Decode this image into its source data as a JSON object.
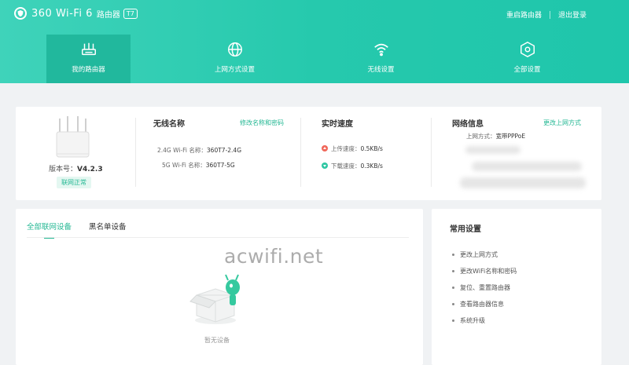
{
  "header": {
    "brand": "360 Wi-Fi 6",
    "subtitle": "路由器",
    "badge": "T7",
    "links": [
      "重启路由器",
      "退出登录"
    ]
  },
  "nav": {
    "items": [
      {
        "label": "我的路由器",
        "icon": "router-icon",
        "active": true
      },
      {
        "label": "上网方式设置",
        "icon": "globe-icon",
        "active": false
      },
      {
        "label": "无线设置",
        "icon": "wifi-icon",
        "active": false
      },
      {
        "label": "全部设置",
        "icon": "hexagon-icon",
        "active": false
      }
    ]
  },
  "router": {
    "version_label": "版本号：",
    "version": "V4.2.3",
    "status": "联网正常"
  },
  "wireless": {
    "title": "无线名称",
    "edit_link": "修改名称和密码",
    "lines": [
      {
        "label": "2.4G Wi-Fi 名称：",
        "value": "360T7-2.4G"
      },
      {
        "label": "5G Wi-Fi 名称：",
        "value": "360T7-5G"
      }
    ]
  },
  "speed": {
    "title": "实时速度",
    "upload_label": "上传速度：",
    "upload": "0.5KB/s",
    "download_label": "下载速度：",
    "download": "0.3KB/s"
  },
  "network": {
    "title": "网络信息",
    "edit_link": "更改上网方式",
    "mode_label": "上网方式：",
    "mode": "宽带PPPoE"
  },
  "devices": {
    "tabs": [
      "全部联网设备",
      "黑名单设备"
    ],
    "empty_text": "暂无设备"
  },
  "watermark": "acwifi.net",
  "quick": {
    "title": "常用设置",
    "links": [
      "更改上网方式",
      "更改WiFi名称和密码",
      "复位、重置路由器",
      "查看路由器信息",
      "系统升级"
    ]
  },
  "colors": {
    "accent": "#25b894",
    "header": "#26c9ad"
  }
}
